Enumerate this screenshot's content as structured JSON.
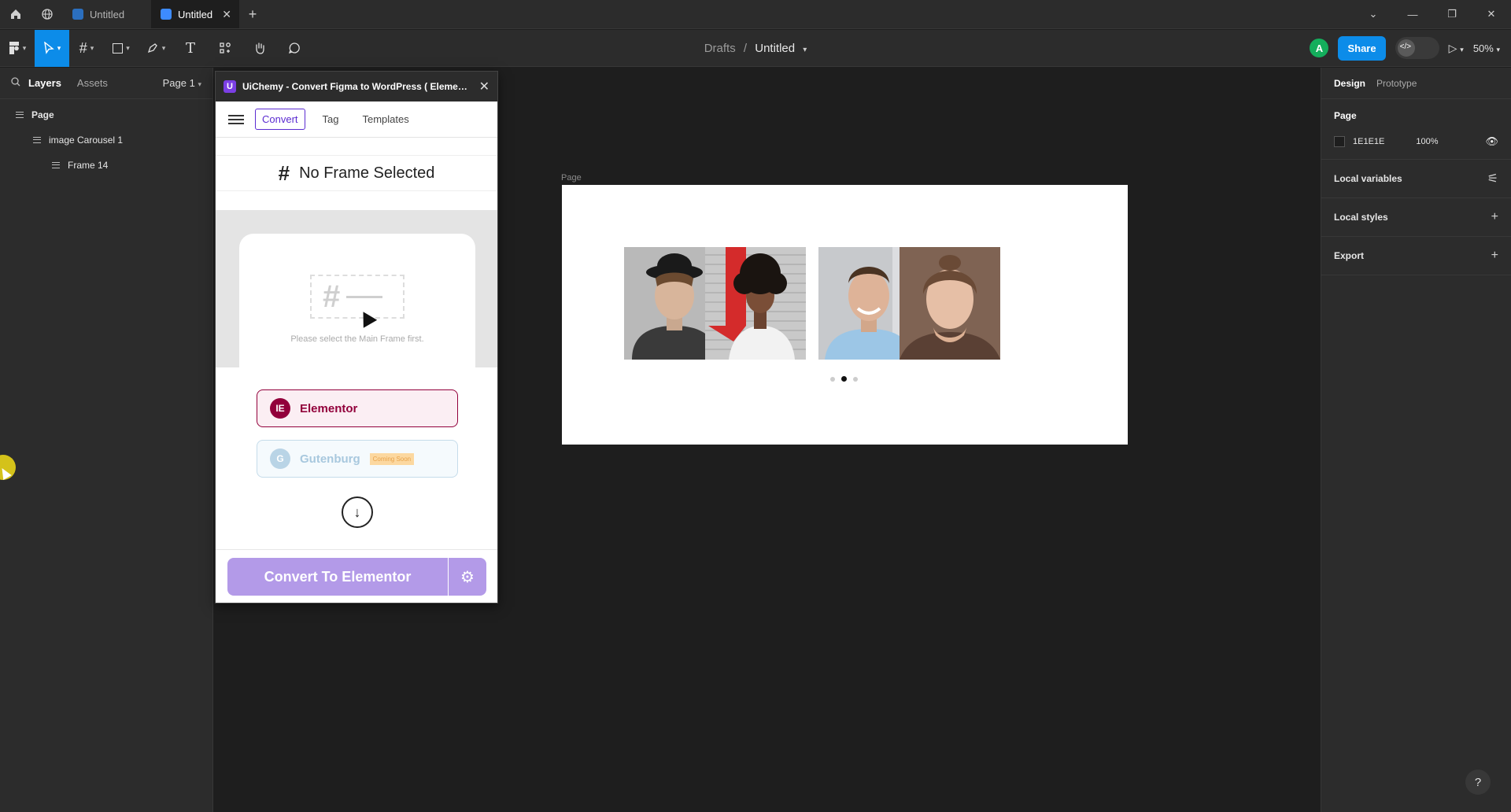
{
  "tabs": [
    {
      "label": "Untitled",
      "active": false
    },
    {
      "label": "Untitled",
      "active": true
    }
  ],
  "toolbar": {
    "breadcrumb_root": "Drafts",
    "breadcrumb_sep": "/",
    "breadcrumb_file": "Untitled",
    "avatar_initial": "A",
    "share_label": "Share",
    "zoom": "50%"
  },
  "left": {
    "tab_layers": "Layers",
    "tab_assets": "Assets",
    "page_select": "Page 1",
    "layers": [
      {
        "label": "Page"
      },
      {
        "label": "image Carousel 1"
      },
      {
        "label": "Frame 14"
      }
    ]
  },
  "plugin": {
    "logo": "U",
    "title": "UiChemy - Convert Figma to WordPress ( Elementor, Gutenberg)",
    "tabs": [
      "Convert",
      "Tag",
      "Templates"
    ],
    "no_frame": "No Frame Selected",
    "placeholder_text": "Please select the Main Frame first.",
    "builder_elementor": "Elementor",
    "builder_gutenburg": "Gutenburg",
    "coming_soon": "Coming Soon",
    "convert_btn": "Convert To Elementor"
  },
  "canvas": {
    "page_label": "Page"
  },
  "right": {
    "tab_design": "Design",
    "tab_prototype": "Prototype",
    "page_heading": "Page",
    "bg_hex": "1E1E1E",
    "bg_opacity": "100%",
    "local_variables": "Local variables",
    "local_styles": "Local styles",
    "export": "Export",
    "help": "?"
  },
  "colors": {
    "accent": "#0c8ce9",
    "plugin_purple": "#5b2bd1",
    "elementor": "#92003b",
    "convert_btn": "#b39ae8"
  }
}
